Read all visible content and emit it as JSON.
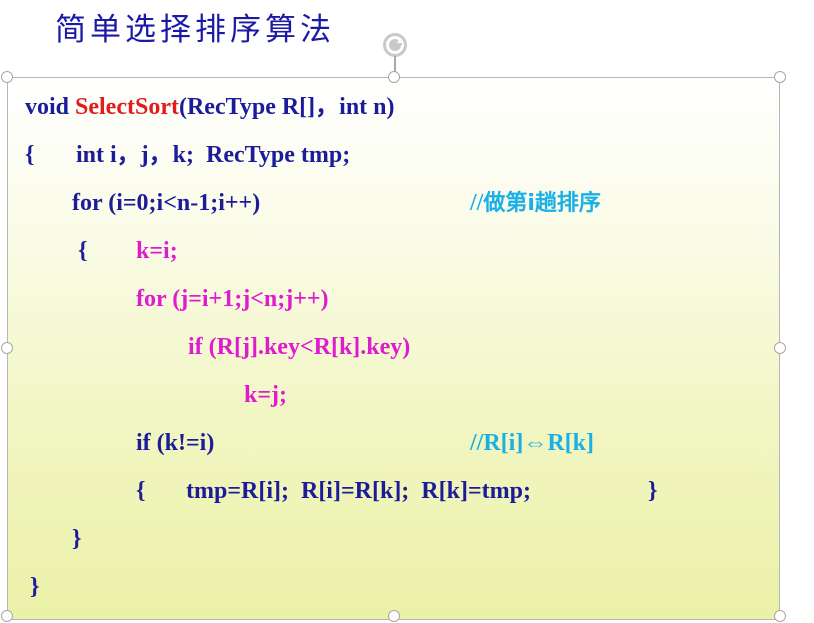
{
  "slide": {
    "title": "简单选择排序算法"
  },
  "code": {
    "line1": {
      "kw": "void ",
      "fn": "SelectSort",
      "rest": "(RecType R[]，int n)"
    },
    "line2": {
      "brace": "{",
      "decl": "int i，j，k;  RecType tmp;"
    },
    "line3": {
      "code": "for (i=0;i<n-1;i++)",
      "comment_prefix": "//",
      "comment_text": "做第i趟排序"
    },
    "line4": {
      "brace": "{",
      "code": "k=i;"
    },
    "line5": {
      "code": "for (j=i+1;j<n;j++)"
    },
    "line6": {
      "code": "if (R[j].key<R[k].key)"
    },
    "line7": {
      "code": "k=j;"
    },
    "line8": {
      "code": "if (k!=i)",
      "comment": "//R[i]⇔R[k]"
    },
    "line9": {
      "brace_open": "{",
      "code": "tmp=R[i];  R[i]=R[k];  R[k]=tmp;",
      "brace_close": "}"
    },
    "line10": {
      "brace": "}"
    },
    "line11": {
      "brace": "}"
    }
  },
  "colors": {
    "title": "#1a1aa6",
    "keyword": "#1c1c9a",
    "function_name": "#e01c1c",
    "highlight": "#e01ad1",
    "comment": "#1ab0e6",
    "box_fill_bottom": "#ebf1a8"
  },
  "icons": {
    "rotate": "rotate-handle-icon"
  }
}
